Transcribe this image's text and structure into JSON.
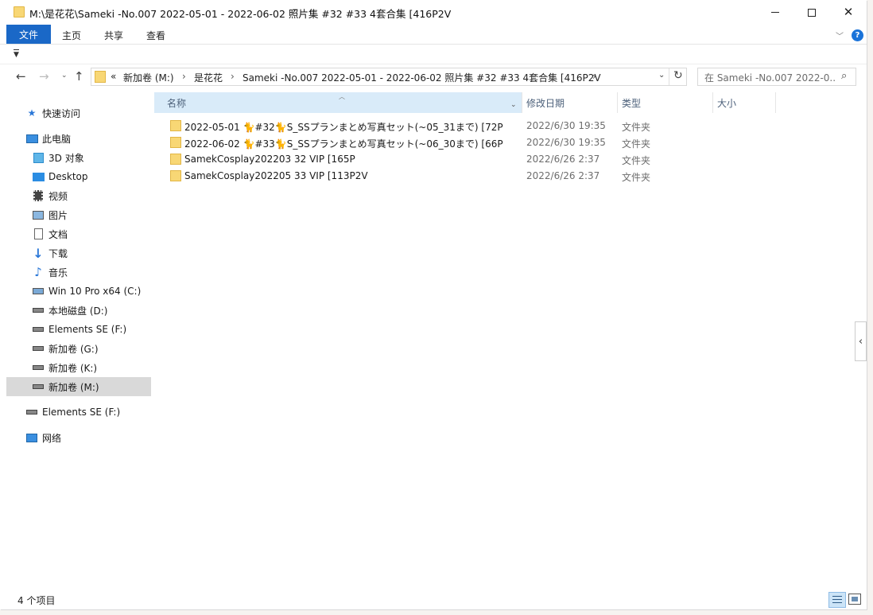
{
  "window": {
    "title": "M:\\是花花\\Sameki -No.007 2022-05-01 - 2022-06-02 照片集 #32 #33 4套合集 [416P2V",
    "close_glyph": "✕"
  },
  "ribbon": {
    "file_label": "文件",
    "home_label": "主页",
    "share_label": "共享",
    "view_label": "查看"
  },
  "address": {
    "overflow": "«",
    "segments": [
      "新加卷 (M:)",
      "是花花",
      "Sameki -No.007 2022-05-01 - 2022-06-02 照片集 #32 #33 4套合集 [416P2V"
    ],
    "separator": "›"
  },
  "search": {
    "placeholder": "在 Sameki -No.007 2022-0..."
  },
  "nav_pane": {
    "items": [
      {
        "label": "快速访问",
        "icon": "star-icon"
      },
      {
        "label": "此电脑",
        "icon": "computer-icon"
      },
      {
        "label": "3D 对象",
        "icon": "cube-icon"
      },
      {
        "label": "Desktop",
        "icon": "desktop-icon"
      },
      {
        "label": "视频",
        "icon": "video-icon"
      },
      {
        "label": "图片",
        "icon": "picture-icon"
      },
      {
        "label": "文档",
        "icon": "document-icon"
      },
      {
        "label": "下载",
        "icon": "download-icon"
      },
      {
        "label": "音乐",
        "icon": "music-icon"
      },
      {
        "label": "Win 10 Pro x64 (C:)",
        "icon": "windows-drive-icon"
      },
      {
        "label": "本地磁盘 (D:)",
        "icon": "drive-icon"
      },
      {
        "label": "Elements SE (F:)",
        "icon": "drive-icon"
      },
      {
        "label": "新加卷 (G:)",
        "icon": "drive-icon"
      },
      {
        "label": "新加卷 (K:)",
        "icon": "drive-icon"
      },
      {
        "label": "新加卷 (M:)",
        "icon": "drive-icon"
      },
      {
        "label": "Elements SE (F:)",
        "icon": "drive-icon"
      },
      {
        "label": "网络",
        "icon": "network-icon"
      }
    ]
  },
  "columns": {
    "name": "名称",
    "date": "修改日期",
    "type": "类型",
    "size": "大小"
  },
  "files": [
    {
      "name": "2022-05-01 🐈#32🐈S_SSプランまとめ写真セット(~05_31まで) [72P",
      "date": "2022/6/30 19:35",
      "type": "文件夹"
    },
    {
      "name": "2022-06-02 🐈#33🐈S_SSプランまとめ写真セット(~06_30まで) [66P",
      "date": "2022/6/30 19:35",
      "type": "文件夹"
    },
    {
      "name": "SamekCosplay202203 32 VIP [165P",
      "date": "2022/6/26 2:37",
      "type": "文件夹"
    },
    {
      "name": "SamekCosplay202205 33 VIP [113P2V",
      "date": "2022/6/26 2:37",
      "type": "文件夹"
    }
  ],
  "status": {
    "item_count": "4 个项目"
  }
}
